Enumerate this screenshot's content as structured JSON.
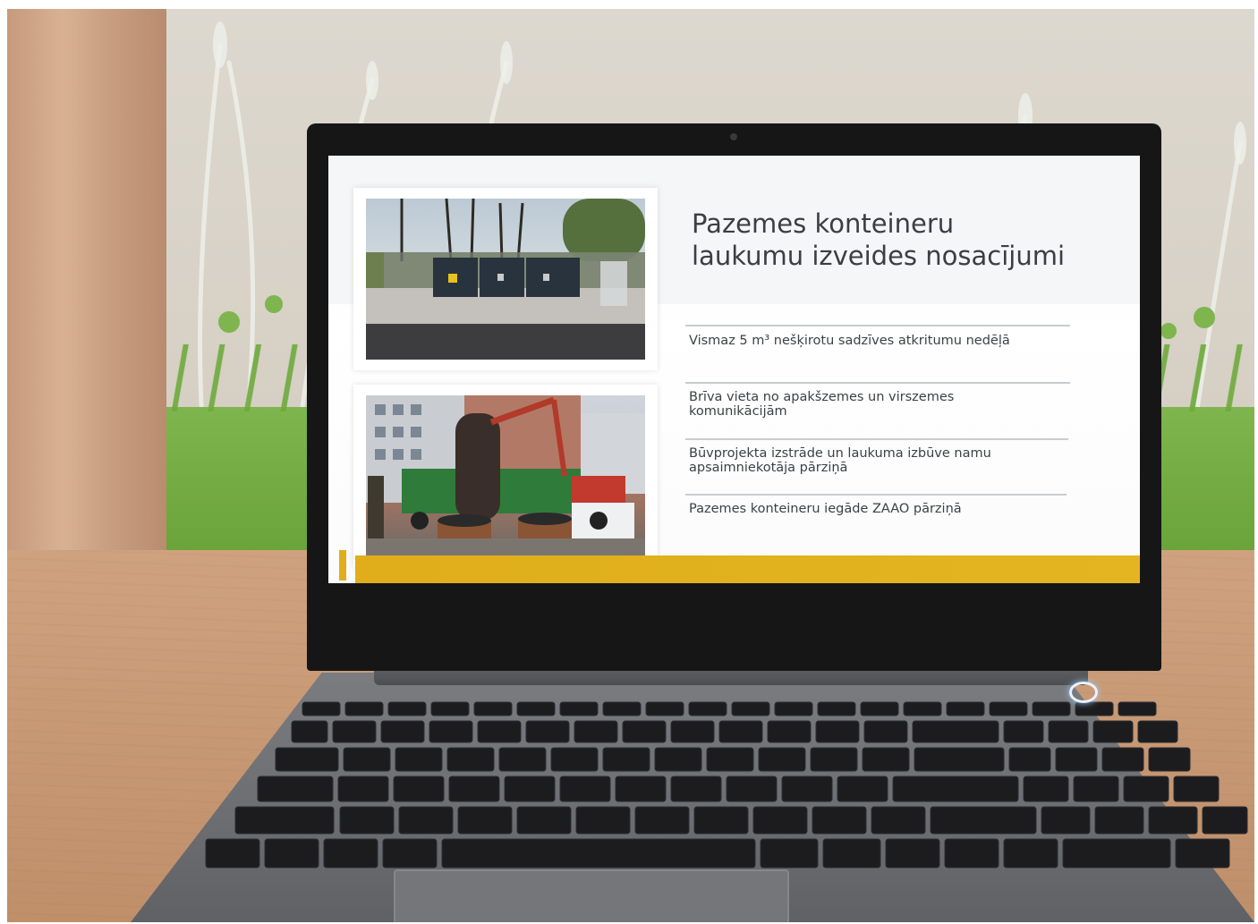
{
  "slide": {
    "title_line1": "Pazemes konteineru",
    "title_line2": "laukumu izveides nosacījumi",
    "bullets": [
      {
        "text": "Vismaz 5 m³ nešķirotu sadzīves atkritumu nedēļā"
      },
      {
        "line1": "Brīva vieta no apakšzemes un virszemes",
        "line2": "komunikācijām"
      },
      {
        "line1": "Būvprojekta izstrāde un laukuma izbūve namu",
        "line2": "apsaimniekotāja pārziņā"
      },
      {
        "text": "Pazemes konteineru iegāde ZAAO pārziņā"
      }
    ]
  },
  "colors": {
    "accent_yellow": "#e0ae1a",
    "title_text": "#3b3e42",
    "bezel": "#161616",
    "wall_green": "#6aa43a"
  },
  "icons": {
    "power": "power-button-icon",
    "camera": "webcam-icon"
  }
}
